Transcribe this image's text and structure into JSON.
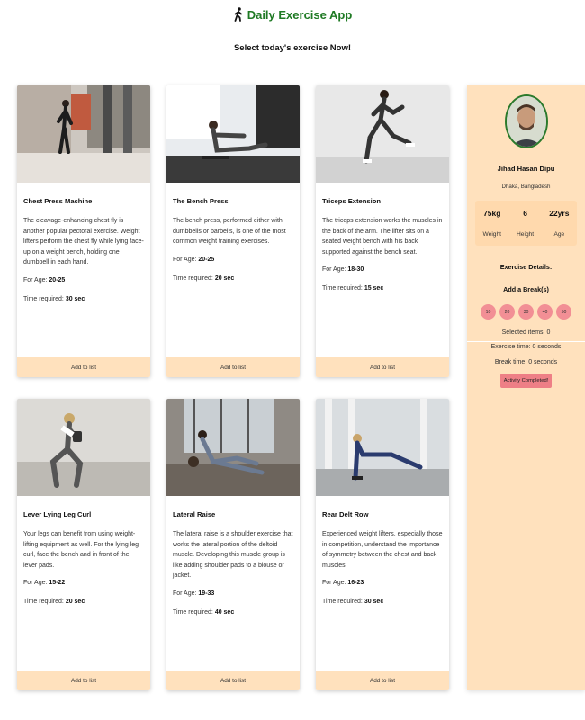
{
  "header": {
    "title": "Daily Exercise App",
    "icon": "walking-person-icon",
    "subtitle": "Select today's exercise Now!"
  },
  "exercises": [
    {
      "title": "Chest Press Machine",
      "description": "The cleavage-enhancing chest fly is another popular pectoral exercise. Weight lifters perform the chest fly while lying face-up on a weight bench, holding one dumbbell in each hand.",
      "age_label": "For Age: ",
      "age": "20-25",
      "time_label": "Time required: ",
      "time": "30 sec",
      "button": "Add to list"
    },
    {
      "title": "The Bench Press",
      "description": "The bench press, performed either with dumbbells or barbells, is one of the most common weight training exercises.",
      "age_label": "For Age: ",
      "age": "20-25",
      "time_label": "Time required: ",
      "time": "20 sec",
      "button": "Add to list"
    },
    {
      "title": "Triceps Extension",
      "description": "The triceps extension works the muscles in the back of the arm. The lifter sits on a seated weight bench with his back supported against the bench seat.",
      "age_label": "For Age: ",
      "age": "18-30",
      "time_label": "Time required: ",
      "time": "15 sec",
      "button": "Add to list"
    },
    {
      "title": "Lever Lying Leg Curl",
      "description": "Your legs can benefit from using weight-lifting equipment as well. For the lying leg curl, face the bench and in front of the lever pads.",
      "age_label": "For Age: ",
      "age": "15-22",
      "time_label": "Time required: ",
      "time": "20 sec",
      "button": "Add to list"
    },
    {
      "title": "Lateral Raise",
      "description": "The lateral raise is a shoulder exercise that works the lateral portion of the deltoid muscle. Developing this muscle group is like adding shoulder pads to a blouse or jacket.",
      "age_label": "For Age: ",
      "age": "19-33",
      "time_label": "Time required: ",
      "time": "40 sec",
      "button": "Add to list"
    },
    {
      "title": "Rear Delt Row",
      "description": "Experienced weight lifters, especially those in competition, understand the importance of symmetry between the chest and back muscles.",
      "age_label": "For Age: ",
      "age": "16-23",
      "time_label": "Time required: ",
      "time": "30 sec",
      "button": "Add to list"
    }
  ],
  "profile": {
    "name": "Jihad Hasan Dipu",
    "location": "Dhaka, Bangladesh",
    "stats": [
      {
        "value": "75kg",
        "label": "Weight"
      },
      {
        "value": "6",
        "label": "Height"
      },
      {
        "value": "22yrs",
        "label": "Age"
      }
    ]
  },
  "details": {
    "exercise_heading": "Exercise Details:",
    "break_heading": "Add a Break(s)",
    "break_options": [
      "10",
      "20",
      "30",
      "40",
      "50"
    ],
    "selected_items": "Selected items: 0",
    "exercise_time": "Exercise time: 0 seconds",
    "break_time": "Break time: 0 seconds",
    "complete_button": "Activity Completed!"
  },
  "colors": {
    "title_green": "#1f7a24",
    "card_button": "#ffe1bd",
    "sidebar_bg": "#ffe1bd",
    "break_circle": "#f28f95",
    "complete_button": "#ee7f86"
  }
}
